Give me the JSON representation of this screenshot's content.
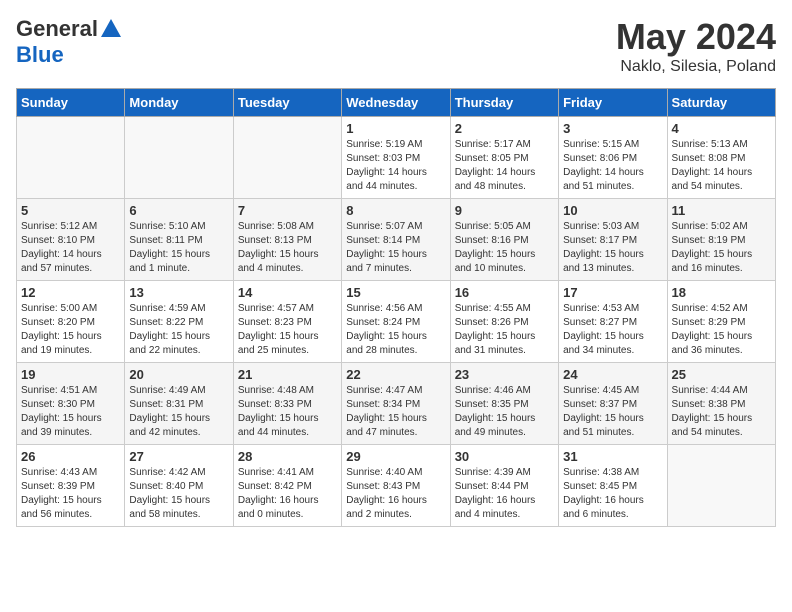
{
  "header": {
    "logo_general": "General",
    "logo_blue": "Blue",
    "month_title": "May 2024",
    "location": "Naklo, Silesia, Poland"
  },
  "days_of_week": [
    "Sunday",
    "Monday",
    "Tuesday",
    "Wednesday",
    "Thursday",
    "Friday",
    "Saturday"
  ],
  "weeks": [
    [
      {
        "day": "",
        "info": ""
      },
      {
        "day": "",
        "info": ""
      },
      {
        "day": "",
        "info": ""
      },
      {
        "day": "1",
        "info": "Sunrise: 5:19 AM\nSunset: 8:03 PM\nDaylight: 14 hours\nand 44 minutes."
      },
      {
        "day": "2",
        "info": "Sunrise: 5:17 AM\nSunset: 8:05 PM\nDaylight: 14 hours\nand 48 minutes."
      },
      {
        "day": "3",
        "info": "Sunrise: 5:15 AM\nSunset: 8:06 PM\nDaylight: 14 hours\nand 51 minutes."
      },
      {
        "day": "4",
        "info": "Sunrise: 5:13 AM\nSunset: 8:08 PM\nDaylight: 14 hours\nand 54 minutes."
      }
    ],
    [
      {
        "day": "5",
        "info": "Sunrise: 5:12 AM\nSunset: 8:10 PM\nDaylight: 14 hours\nand 57 minutes."
      },
      {
        "day": "6",
        "info": "Sunrise: 5:10 AM\nSunset: 8:11 PM\nDaylight: 15 hours\nand 1 minute."
      },
      {
        "day": "7",
        "info": "Sunrise: 5:08 AM\nSunset: 8:13 PM\nDaylight: 15 hours\nand 4 minutes."
      },
      {
        "day": "8",
        "info": "Sunrise: 5:07 AM\nSunset: 8:14 PM\nDaylight: 15 hours\nand 7 minutes."
      },
      {
        "day": "9",
        "info": "Sunrise: 5:05 AM\nSunset: 8:16 PM\nDaylight: 15 hours\nand 10 minutes."
      },
      {
        "day": "10",
        "info": "Sunrise: 5:03 AM\nSunset: 8:17 PM\nDaylight: 15 hours\nand 13 minutes."
      },
      {
        "day": "11",
        "info": "Sunrise: 5:02 AM\nSunset: 8:19 PM\nDaylight: 15 hours\nand 16 minutes."
      }
    ],
    [
      {
        "day": "12",
        "info": "Sunrise: 5:00 AM\nSunset: 8:20 PM\nDaylight: 15 hours\nand 19 minutes."
      },
      {
        "day": "13",
        "info": "Sunrise: 4:59 AM\nSunset: 8:22 PM\nDaylight: 15 hours\nand 22 minutes."
      },
      {
        "day": "14",
        "info": "Sunrise: 4:57 AM\nSunset: 8:23 PM\nDaylight: 15 hours\nand 25 minutes."
      },
      {
        "day": "15",
        "info": "Sunrise: 4:56 AM\nSunset: 8:24 PM\nDaylight: 15 hours\nand 28 minutes."
      },
      {
        "day": "16",
        "info": "Sunrise: 4:55 AM\nSunset: 8:26 PM\nDaylight: 15 hours\nand 31 minutes."
      },
      {
        "day": "17",
        "info": "Sunrise: 4:53 AM\nSunset: 8:27 PM\nDaylight: 15 hours\nand 34 minutes."
      },
      {
        "day": "18",
        "info": "Sunrise: 4:52 AM\nSunset: 8:29 PM\nDaylight: 15 hours\nand 36 minutes."
      }
    ],
    [
      {
        "day": "19",
        "info": "Sunrise: 4:51 AM\nSunset: 8:30 PM\nDaylight: 15 hours\nand 39 minutes."
      },
      {
        "day": "20",
        "info": "Sunrise: 4:49 AM\nSunset: 8:31 PM\nDaylight: 15 hours\nand 42 minutes."
      },
      {
        "day": "21",
        "info": "Sunrise: 4:48 AM\nSunset: 8:33 PM\nDaylight: 15 hours\nand 44 minutes."
      },
      {
        "day": "22",
        "info": "Sunrise: 4:47 AM\nSunset: 8:34 PM\nDaylight: 15 hours\nand 47 minutes."
      },
      {
        "day": "23",
        "info": "Sunrise: 4:46 AM\nSunset: 8:35 PM\nDaylight: 15 hours\nand 49 minutes."
      },
      {
        "day": "24",
        "info": "Sunrise: 4:45 AM\nSunset: 8:37 PM\nDaylight: 15 hours\nand 51 minutes."
      },
      {
        "day": "25",
        "info": "Sunrise: 4:44 AM\nSunset: 8:38 PM\nDaylight: 15 hours\nand 54 minutes."
      }
    ],
    [
      {
        "day": "26",
        "info": "Sunrise: 4:43 AM\nSunset: 8:39 PM\nDaylight: 15 hours\nand 56 minutes."
      },
      {
        "day": "27",
        "info": "Sunrise: 4:42 AM\nSunset: 8:40 PM\nDaylight: 15 hours\nand 58 minutes."
      },
      {
        "day": "28",
        "info": "Sunrise: 4:41 AM\nSunset: 8:42 PM\nDaylight: 16 hours\nand 0 minutes."
      },
      {
        "day": "29",
        "info": "Sunrise: 4:40 AM\nSunset: 8:43 PM\nDaylight: 16 hours\nand 2 minutes."
      },
      {
        "day": "30",
        "info": "Sunrise: 4:39 AM\nSunset: 8:44 PM\nDaylight: 16 hours\nand 4 minutes."
      },
      {
        "day": "31",
        "info": "Sunrise: 4:38 AM\nSunset: 8:45 PM\nDaylight: 16 hours\nand 6 minutes."
      },
      {
        "day": "",
        "info": ""
      }
    ]
  ]
}
